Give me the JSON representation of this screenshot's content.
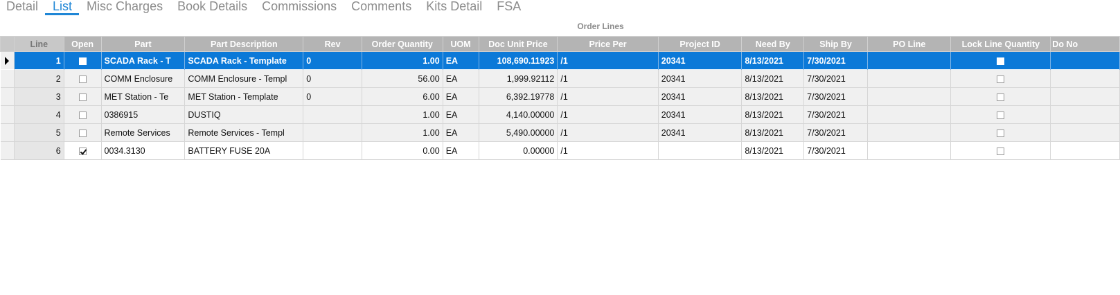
{
  "tabs": [
    {
      "label": "Detail"
    },
    {
      "label": "List"
    },
    {
      "label": "Misc Charges"
    },
    {
      "label": "Book Details"
    },
    {
      "label": "Commissions"
    },
    {
      "label": "Comments"
    },
    {
      "label": "Kits Detail"
    },
    {
      "label": "FSA"
    }
  ],
  "active_tab": "List",
  "grid": {
    "caption": "Order Lines",
    "columns": [
      "Line",
      "Open",
      "Part",
      "Part Description",
      "Rev",
      "Order Quantity",
      "UOM",
      "Doc Unit Price",
      "Price Per",
      "Project ID",
      "Need By",
      "Ship By",
      "PO Line",
      "Lock Line Quantity",
      "Do No"
    ],
    "rows": [
      {
        "line": "1",
        "open": false,
        "part": "SCADA Rack - T",
        "description": "SCADA Rack - Template",
        "rev": "0",
        "qty": "1.00",
        "uom": "EA",
        "price": "108,690.11923",
        "per": "/1",
        "project": "20341",
        "need_by": "8/13/2021",
        "ship_by": "7/30/2021",
        "po_line": "",
        "lock": false,
        "selected": true
      },
      {
        "line": "2",
        "open": false,
        "part": "COMM Enclosure",
        "description": "COMM Enclosure - Templ",
        "rev": "0",
        "qty": "56.00",
        "uom": "EA",
        "price": "1,999.92112",
        "per": "/1",
        "project": "20341",
        "need_by": "8/13/2021",
        "ship_by": "7/30/2021",
        "po_line": "",
        "lock": false,
        "selected": false
      },
      {
        "line": "3",
        "open": false,
        "part": "MET Station - Te",
        "description": "MET Station - Template",
        "rev": "0",
        "qty": "6.00",
        "uom": "EA",
        "price": "6,392.19778",
        "per": "/1",
        "project": "20341",
        "need_by": "8/13/2021",
        "ship_by": "7/30/2021",
        "po_line": "",
        "lock": false,
        "selected": false
      },
      {
        "line": "4",
        "open": false,
        "part": "0386915",
        "description": "DUSTIQ",
        "rev": "",
        "qty": "1.00",
        "uom": "EA",
        "price": "4,140.00000",
        "per": "/1",
        "project": "20341",
        "need_by": "8/13/2021",
        "ship_by": "7/30/2021",
        "po_line": "",
        "lock": false,
        "selected": false
      },
      {
        "line": "5",
        "open": false,
        "part": "Remote Services",
        "description": "Remote Services - Templ",
        "rev": "",
        "qty": "1.00",
        "uom": "EA",
        "price": "5,490.00000",
        "per": "/1",
        "project": "20341",
        "need_by": "8/13/2021",
        "ship_by": "7/30/2021",
        "po_line": "",
        "lock": false,
        "selected": false
      },
      {
        "line": "6",
        "open": true,
        "part": "0034.3130",
        "description": "BATTERY FUSE 20A",
        "rev": "",
        "qty": "0.00",
        "uom": "EA",
        "price": "0.00000",
        "per": "/1",
        "project": "",
        "need_by": "8/13/2021",
        "ship_by": "7/30/2021",
        "po_line": "",
        "lock": false,
        "selected": false
      }
    ]
  }
}
